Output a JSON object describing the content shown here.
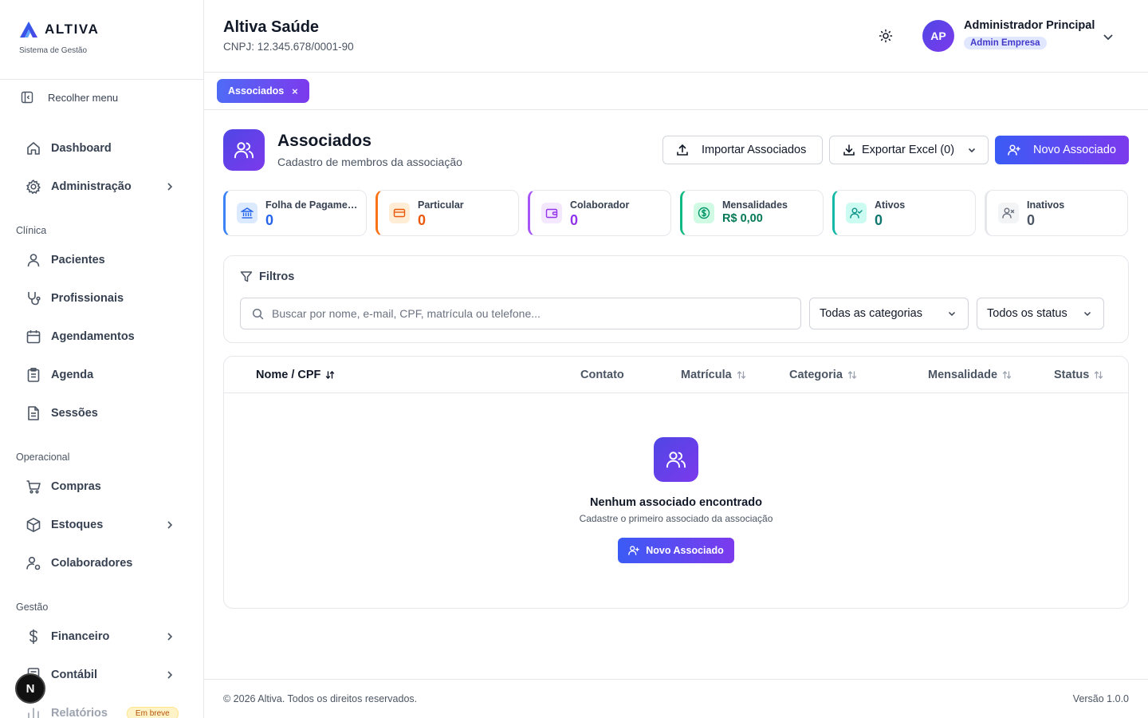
{
  "brand": {
    "name": "ALTIVA",
    "subtitle": "Sistema de Gestão",
    "accent": "#4f46e5"
  },
  "sidebar": {
    "collapse_label": "Recolher menu",
    "items": [
      {
        "label": "Dashboard",
        "icon": "home-icon"
      },
      {
        "label": "Administração",
        "icon": "gear-icon"
      }
    ],
    "sections": [
      {
        "title": "Clínica",
        "items": [
          {
            "label": "Pacientes",
            "icon": "user-icon"
          },
          {
            "label": "Profissionais",
            "icon": "stethoscope-icon"
          },
          {
            "label": "Agendamentos",
            "icon": "calendar-icon"
          },
          {
            "label": "Agenda",
            "icon": "clipboard-icon"
          },
          {
            "label": "Sessões",
            "icon": "document-icon"
          }
        ]
      },
      {
        "title": "Operacional",
        "items": [
          {
            "label": "Compras",
            "icon": "cart-icon"
          },
          {
            "label": "Estoques",
            "icon": "box-icon"
          },
          {
            "label": "Colaboradores",
            "icon": "user-settings-icon"
          }
        ]
      },
      {
        "title": "Gestão",
        "items": [
          {
            "label": "Financeiro",
            "icon": "dollar-icon"
          },
          {
            "label": "Contábil",
            "icon": "calculator-icon"
          },
          {
            "label": "Relatórios",
            "icon": "bar-chart-icon",
            "badge": "Em breve"
          }
        ]
      }
    ],
    "dev_badge": "N"
  },
  "header": {
    "org_name": "Altiva Saúde",
    "org_cnpj": "CNPJ: 12.345.678/0001-90",
    "user_initials": "AP",
    "user_name": "Administrador Principal",
    "user_role": "Admin Empresa"
  },
  "tabs": [
    {
      "label": "Associados",
      "close": "×"
    }
  ],
  "page": {
    "title": "Associados",
    "subtitle": "Cadastro de membros da associação",
    "actions": {
      "import_label": "Importar Associados",
      "export_label": "Exportar Excel (0)",
      "new_label": "Novo Associado"
    }
  },
  "stats": [
    {
      "label": "Folha de Pagamento",
      "value": "0",
      "color": "#3b82f6"
    },
    {
      "label": "Particular",
      "value": "0",
      "color": "#f97316"
    },
    {
      "label": "Colaborador",
      "value": "0",
      "color": "#a855f7"
    },
    {
      "label": "Mensalidades",
      "value": "R$ 0,00",
      "color": "#10b981"
    },
    {
      "label": "Ativos",
      "value": "0",
      "color": "#14b8a6"
    },
    {
      "label": "Inativos",
      "value": "0",
      "color": "#9ca3af"
    }
  ],
  "filters": {
    "title": "Filtros",
    "search_placeholder": "Buscar por nome, e-mail, CPF, matrícula ou telefone...",
    "category_selected": "Todas as categorias",
    "status_selected": "Todos os status"
  },
  "table": {
    "columns": [
      "Nome / CPF",
      "Contato",
      "Matrícula",
      "Categoria",
      "Mensalidade",
      "Status"
    ],
    "empty_title": "Nenhum associado encontrado",
    "empty_subtitle": "Cadastre o primeiro associado da associação",
    "empty_button": "Novo Associado"
  },
  "footer": {
    "copyright": "© 2026 Altiva. Todos os direitos reservados.",
    "version": "Versão 1.0.0"
  }
}
